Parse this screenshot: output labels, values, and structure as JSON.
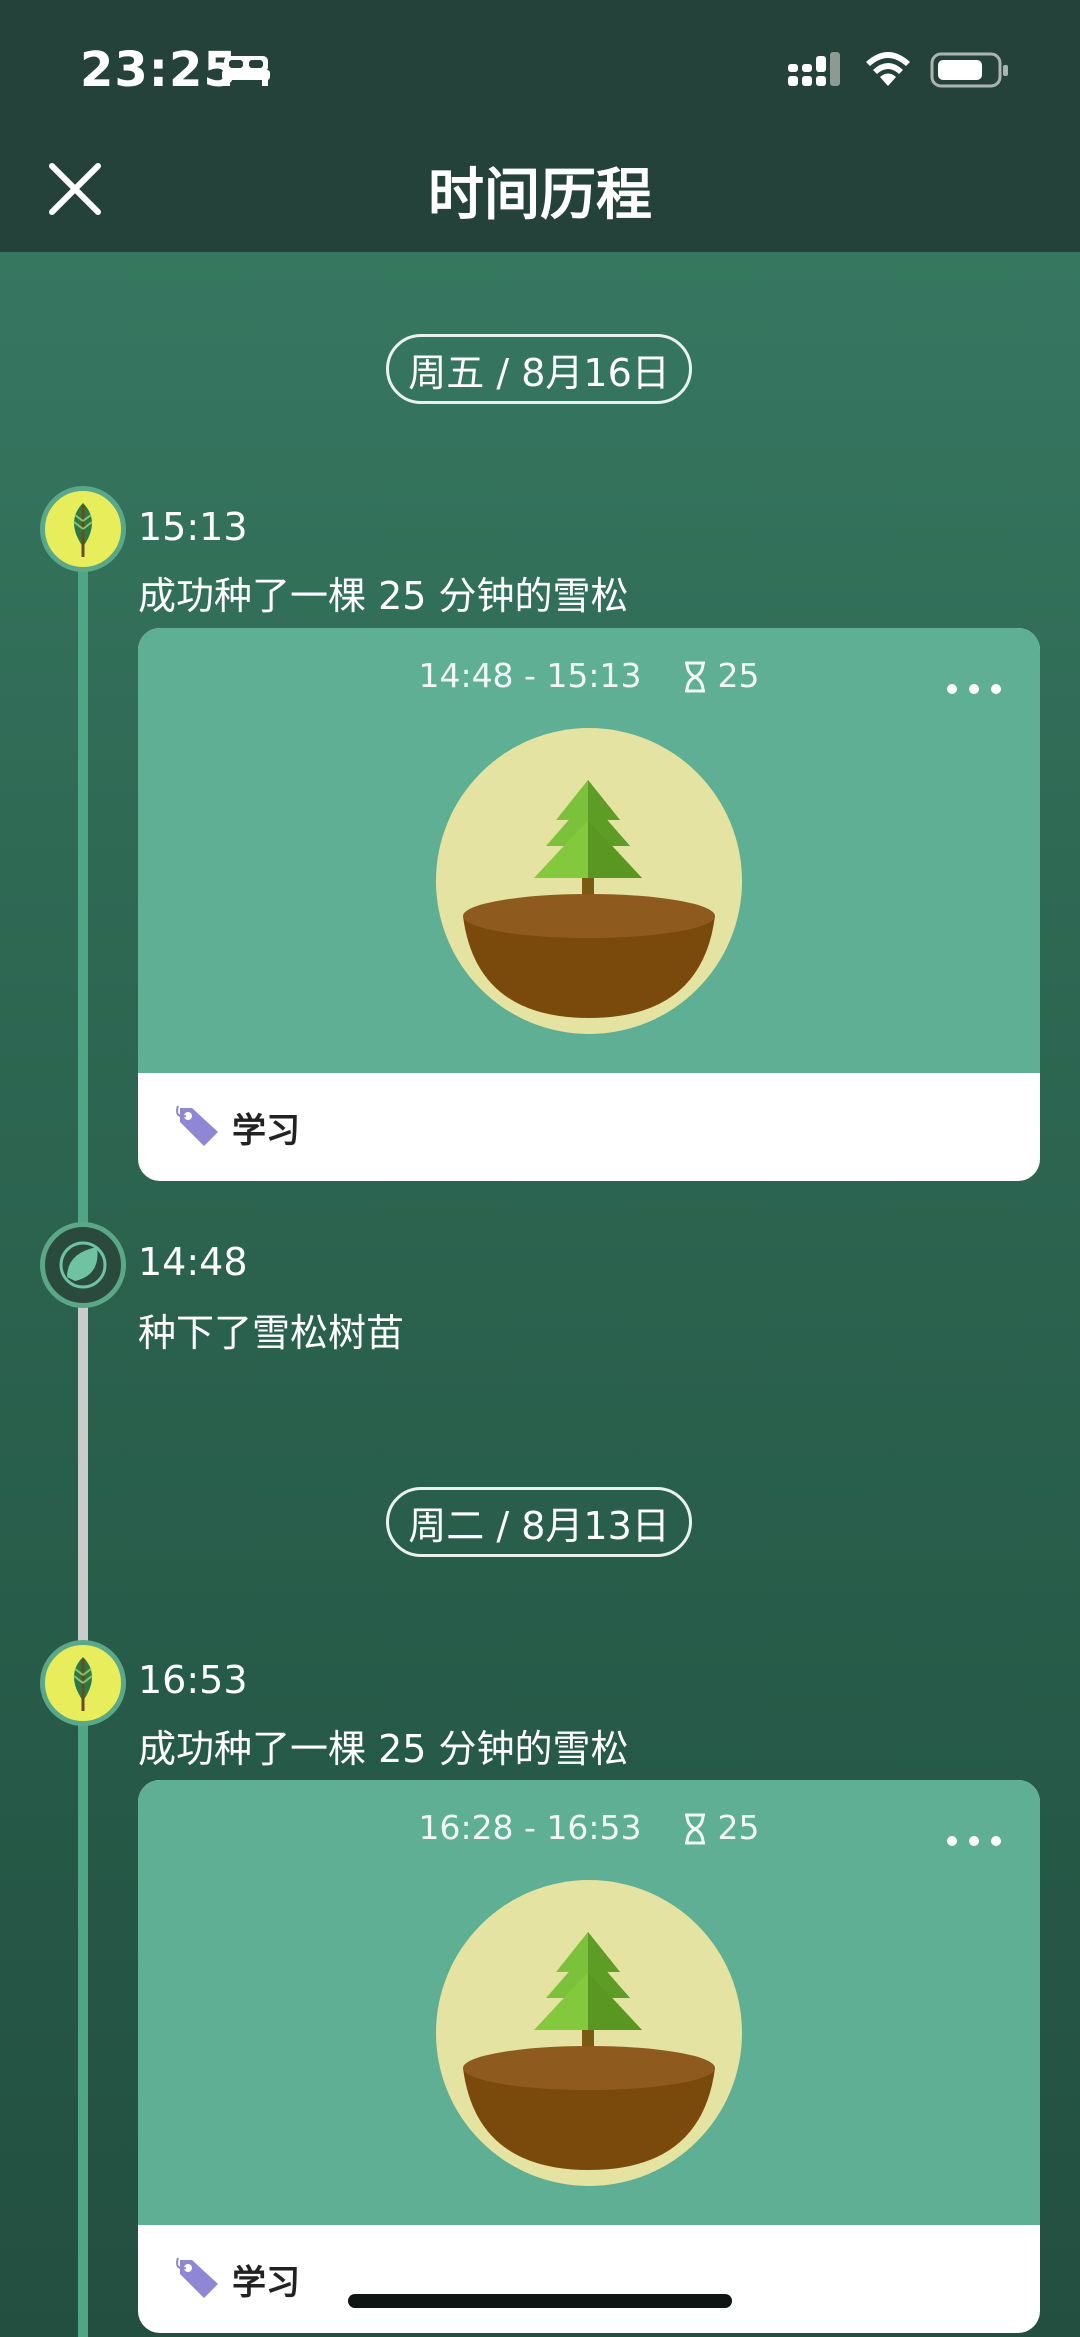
{
  "status_bar": {
    "time": "23:25"
  },
  "header": {
    "title": "时间历程"
  },
  "groups": [
    {
      "date": "周五 / 8月16日",
      "events": [
        {
          "time": "15:13",
          "text": "成功种了一棵 25 分钟的雪松",
          "card": {
            "range": "14:48 - 15:13",
            "minutes": "25",
            "tag": "学习"
          }
        },
        {
          "time": "14:48",
          "text": "种下了雪松树苗"
        }
      ]
    },
    {
      "date": "周二 / 8月13日",
      "events": [
        {
          "time": "16:53",
          "text": "成功种了一棵 25 分钟的雪松",
          "card": {
            "range": "16:28 - 16:53",
            "minutes": "25",
            "tag": "学习"
          }
        }
      ]
    }
  ],
  "colors": {
    "accent": "#5faf95",
    "header": "#25423a",
    "tag": "#8f86d6"
  }
}
